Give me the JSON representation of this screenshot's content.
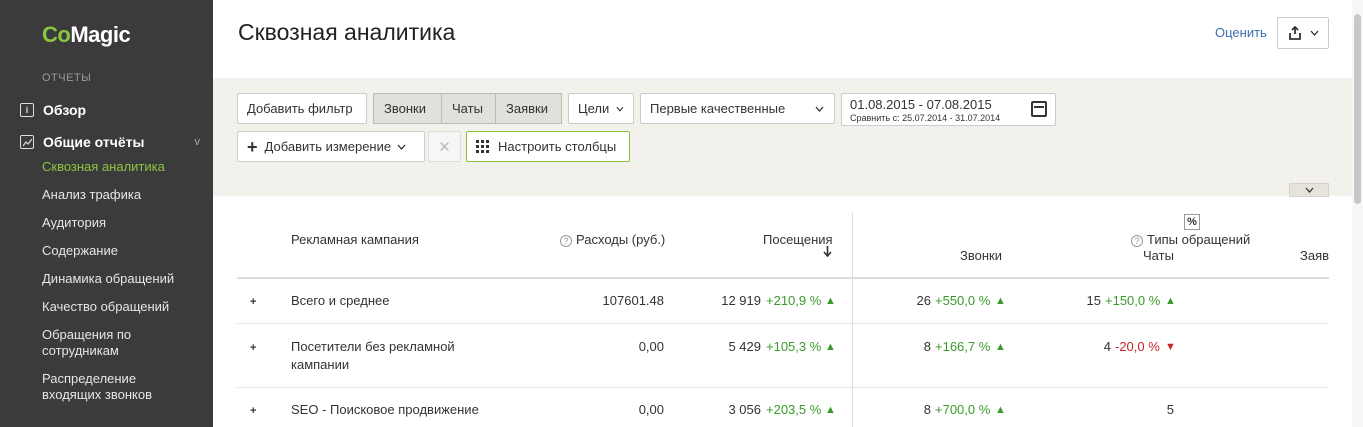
{
  "sidebar": {
    "logo_co": "Co",
    "logo_magic": "Magic",
    "section_label": "ОТЧЕТЫ",
    "overview": "Обзор",
    "general_reports": "Общие отчёты",
    "general_chevron": "v",
    "items": [
      "Сквозная аналитика",
      "Анализ трафика",
      "Аудитория",
      "Содержание",
      "Динамика обращений",
      "Качество обращений",
      "Обращения по сотрудникам",
      "Распределение входящих звонков"
    ]
  },
  "header": {
    "title": "Сквозная аналитика",
    "rate_link": "Оценить"
  },
  "filters": {
    "add_filter": "Добавить фильтр",
    "segments": [
      "Звонки",
      "Чаты",
      "Заявки"
    ],
    "goals": "Цели",
    "quality": "Первые качественные",
    "date_range": "01.08.2015 - 07.08.2015",
    "compare": "Сравнить с: 25.07.2014 - 31.07.2014",
    "add_dimension": "Добавить измерение",
    "configure_columns": "Настроить столбцы"
  },
  "table": {
    "headers": {
      "campaign": "Рекламная кампания",
      "expenses": "Расходы (руб.)",
      "visits": "Посещения",
      "percent_toggle": "%",
      "request_types": "Типы обращений",
      "calls": "Звонки",
      "chats": "Чаты",
      "requests": "Заяв"
    },
    "rows": [
      {
        "name": "Всего и среднее",
        "expenses": "107601.48",
        "visits": "12 919",
        "visits_delta": "+210,9 %",
        "calls": "26",
        "calls_delta": "+550,0 %",
        "chats": "15",
        "chats_delta": "+150,0 %"
      },
      {
        "name": "Посетители без рекламной кампании",
        "expenses": "0,00",
        "visits": "5 429",
        "visits_delta": "+105,3 %",
        "calls": "8",
        "calls_delta": "+166,7 %",
        "chats": "4",
        "chats_delta": "-20,0 %"
      },
      {
        "name": "SEO - Поисковое продвижение",
        "expenses": "0,00",
        "visits": "3 056",
        "visits_delta": "+203,5 %",
        "calls": "8",
        "calls_delta": "+700,0 %",
        "chats": "5",
        "chats_delta": ""
      }
    ]
  },
  "colors": {
    "sidebar_bg": "#3b3b3b",
    "accent_green": "#8bc53f",
    "positive": "#3a9b2b",
    "negative": "#c62828",
    "link": "#3a6fb0"
  }
}
